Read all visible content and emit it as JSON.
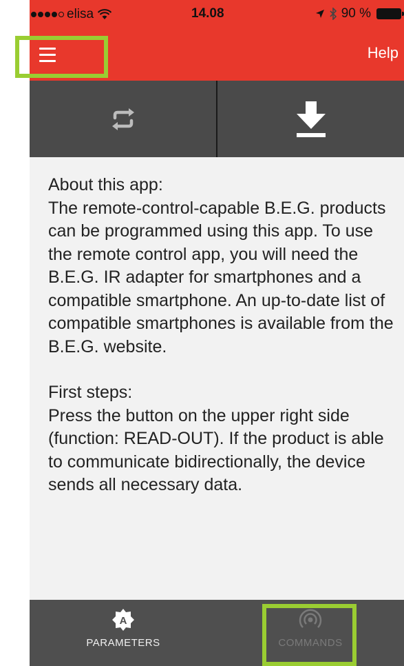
{
  "status_bar": {
    "carrier": "elisa",
    "time": "14.08",
    "battery_percent": "90 %"
  },
  "nav": {
    "help_label": "Help"
  },
  "content": {
    "about_heading": "About this app:",
    "about_text": "The remote-control-capable B.E.G. products can be programmed using this app. To use the remote control app, you will need the B.E.G. IR adapter for smartphones and a compatible smartphone. An up-to-date list of compatible smartphones is available from the B.E.G. website.",
    "steps_heading": "First steps:",
    "steps_text": "Press the button on the upper right side (function: READ-OUT). If the product is able to communicate bidirectionally, the device sends all necessary data."
  },
  "tabs": [
    {
      "label": "PARAMETERS",
      "icon": "parameters-icon"
    },
    {
      "label": "COMMANDS",
      "icon": "commands-icon"
    }
  ],
  "colors": {
    "accent": "#e8382c",
    "toolbar": "#4a4a4a",
    "tabbar": "#4f4f4f",
    "highlight": "#9acd32"
  }
}
